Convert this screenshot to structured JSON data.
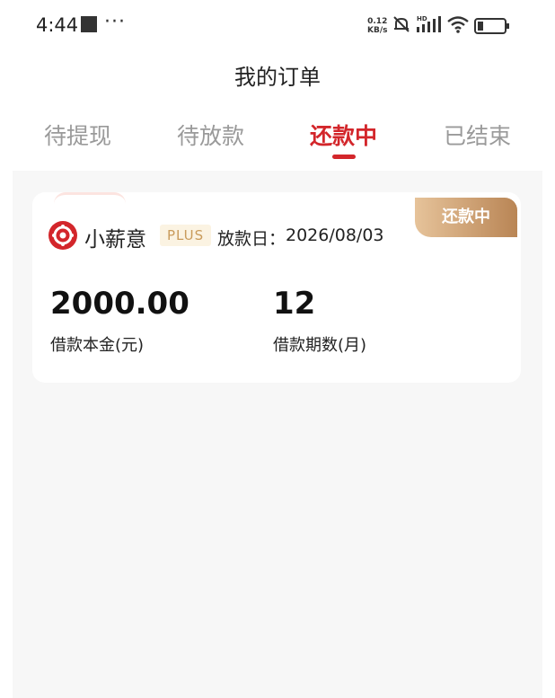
{
  "status_bar": {
    "time": "4:44",
    "more": "···",
    "net_speed_value": "0.12",
    "net_speed_unit": "KB/s",
    "hd_label": "HD",
    "icons": [
      "stop-square-icon",
      "bell-muted-icon",
      "signal-icon",
      "wifi-icon",
      "battery-icon"
    ]
  },
  "header": {
    "title": "我的订单"
  },
  "tabs": [
    {
      "label": "待提现",
      "active": false
    },
    {
      "label": "待放款",
      "active": false
    },
    {
      "label": "还款中",
      "active": true
    },
    {
      "label": "已结束",
      "active": false
    }
  ],
  "order_card": {
    "status_badge": "还款中",
    "brand_name": "小薪意",
    "brand_tag": "PLUS",
    "disburse_label": "放款日：",
    "disburse_date": "2026/08/03",
    "amount": "2000.00",
    "amount_label": "借款本金(元)",
    "term": "12",
    "term_label": "借款期数(月)"
  },
  "colors": {
    "accent": "#d3262b",
    "tab_inactive": "#9a9a9a",
    "badge_gradient_start": "#e6c39a",
    "badge_gradient_end": "#b98555",
    "plus_bg": "#fbf3e2",
    "plus_text": "#c99b5b",
    "content_bg": "#f7f7f7"
  }
}
